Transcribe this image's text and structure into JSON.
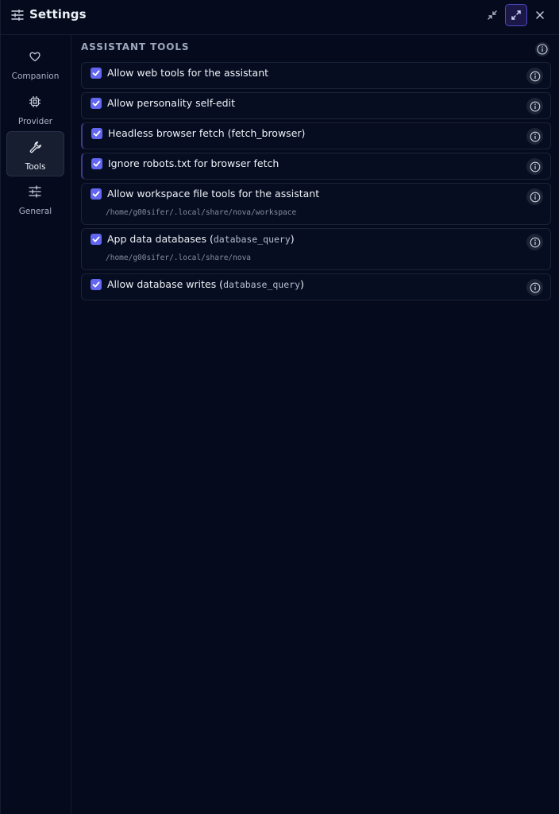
{
  "header": {
    "title": "Settings"
  },
  "sidebar": {
    "items": [
      {
        "label": "Companion",
        "icon": "heart-icon"
      },
      {
        "label": "Provider",
        "icon": "chip-icon"
      },
      {
        "label": "Tools",
        "icon": "wrench-icon",
        "active": true
      },
      {
        "label": "General",
        "icon": "sliders-icon"
      }
    ]
  },
  "section": {
    "title": "ASSISTANT TOOLS"
  },
  "settings": [
    {
      "label": "Allow web tools for the assistant",
      "checked": true
    },
    {
      "label": "Allow personality self-edit",
      "checked": true
    },
    {
      "label": "Headless browser fetch (fetch_browser)",
      "checked": true
    },
    {
      "label": "Ignore robots.txt for browser fetch",
      "checked": true
    },
    {
      "label": "Allow workspace file tools for the assistant",
      "path": "/home/g00sifer/.local/share/nova/workspace",
      "checked": true
    },
    {
      "label_prefix": "App data databases (",
      "label_code": "database_query",
      "label_suffix": ")",
      "path": "/home/g00sifer/.local/share/nova",
      "checked": true
    },
    {
      "label_prefix": "Allow database writes (",
      "label_code": "database_query",
      "label_suffix": ")",
      "checked": true
    }
  ],
  "colors": {
    "accent": "#6366f1",
    "background": "#050b1c",
    "border": "#1a2338"
  }
}
